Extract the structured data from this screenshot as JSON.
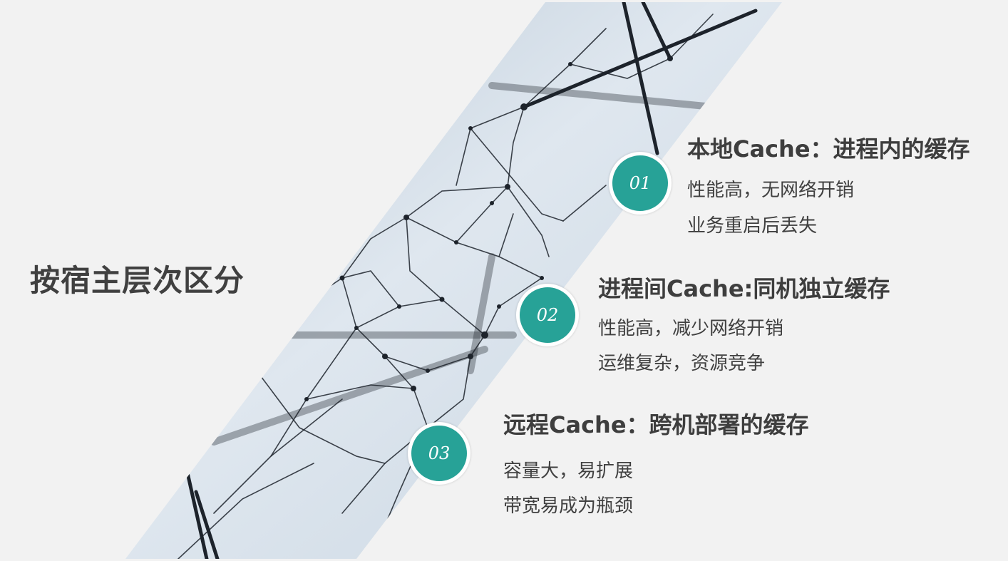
{
  "slide": {
    "title": "按宿主层次区分",
    "accent_color": "#27a297",
    "items": [
      {
        "number": "01",
        "title": "本地Cache：进程内的缓存",
        "lines": [
          "性能高，无网络开销",
          "业务重启后丢失"
        ]
      },
      {
        "number": "02",
        "title": "进程间Cache:同机独立缓存",
        "lines": [
          "性能高，减少网络开销",
          "运维复杂，资源竞争"
        ]
      },
      {
        "number": "03",
        "title": "远程Cache：跨机部署的缓存",
        "lines": [
          "容量大，易扩展",
          "带宽易成为瓶颈"
        ]
      }
    ]
  }
}
